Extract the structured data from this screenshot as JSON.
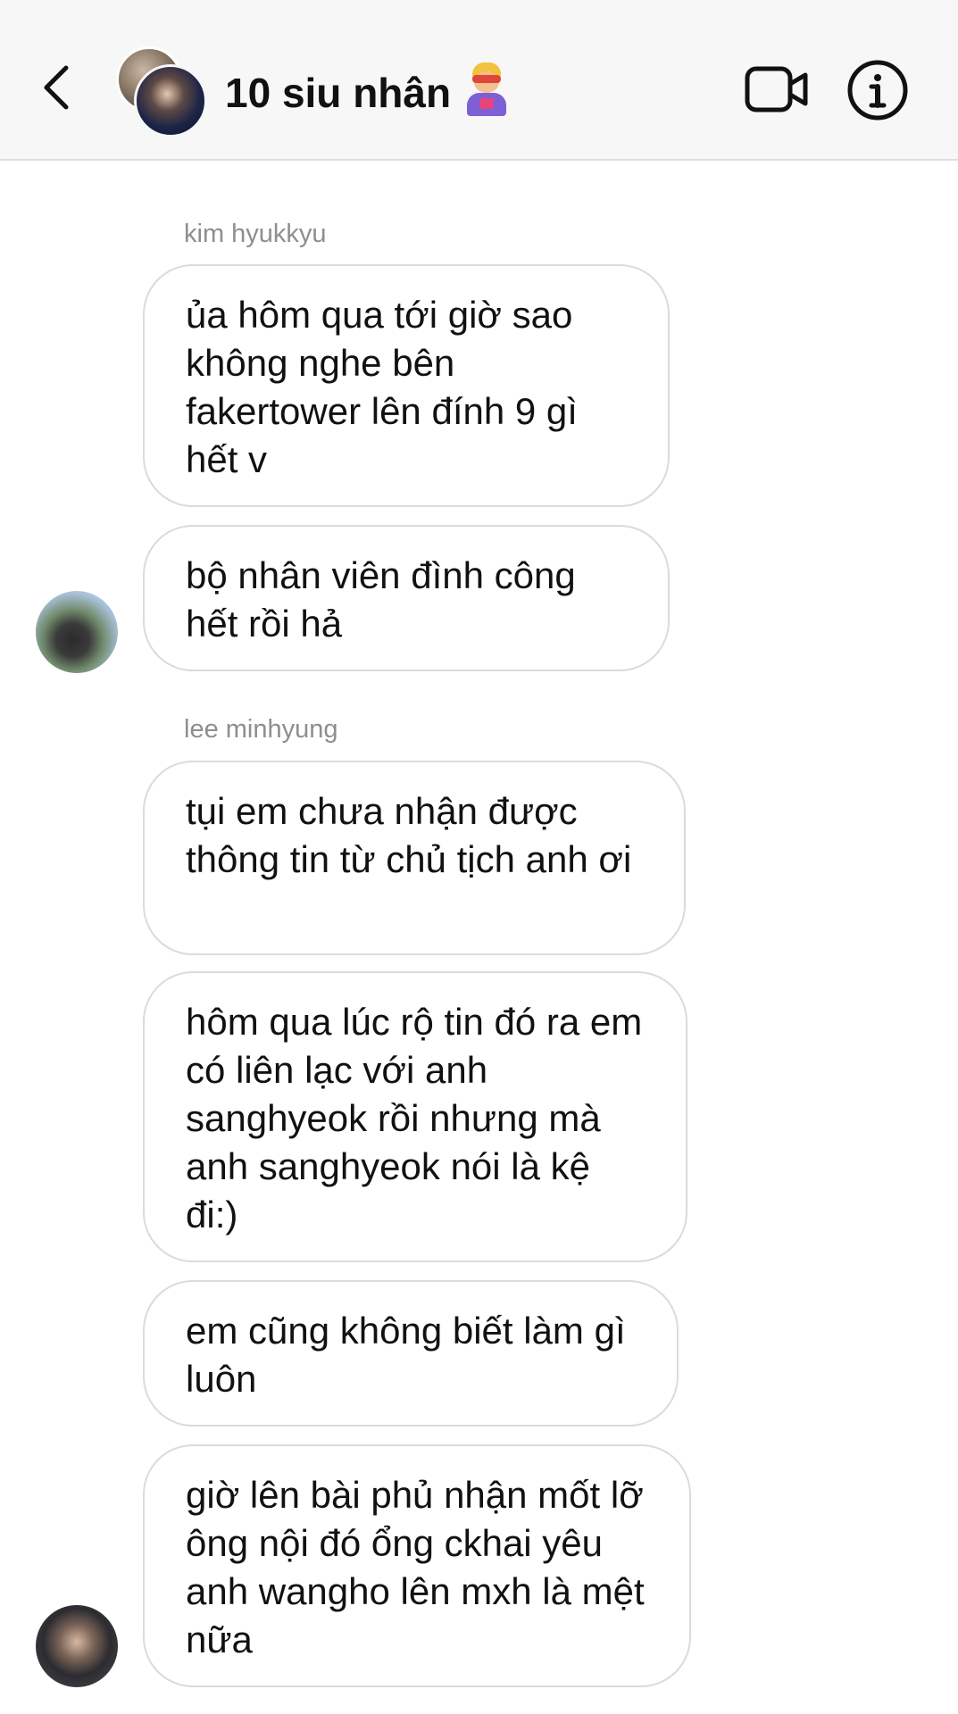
{
  "header": {
    "title": "10 siu nhân",
    "title_emoji": "superhero-icon",
    "back_icon": "chevron-left-icon",
    "video_icon": "video-camera-icon",
    "info_icon": "info-icon"
  },
  "messages": {
    "group1": {
      "sender": "kim hyukkyu",
      "bubbles": [
        "ủa hôm qua tới giờ sao không nghe bên fakertower lên đính 9 gì hết v",
        "bộ nhân viên đình công hết rồi hả"
      ]
    },
    "group2": {
      "sender": "lee minhyung",
      "bubbles": [
        "tụi em chưa nhận được thông tin từ chủ tịch anh ơi",
        "hôm qua lúc rộ tin đó ra em có liên lạc với anh sanghyeok rồi nhưng mà anh sanghyeok nói là kệ đi:)",
        "em cũng không biết làm gì luôn",
        "giờ lên bài phủ nhận mốt lỡ ông nội đó ổng ckhai yêu anh wangho lên mxh là mệt nữa"
      ]
    }
  },
  "colors": {
    "header_bg": "#f7f7f7",
    "bubble_border": "#dbdbdb",
    "sender_text": "#8e8e8e",
    "text": "#111111"
  }
}
